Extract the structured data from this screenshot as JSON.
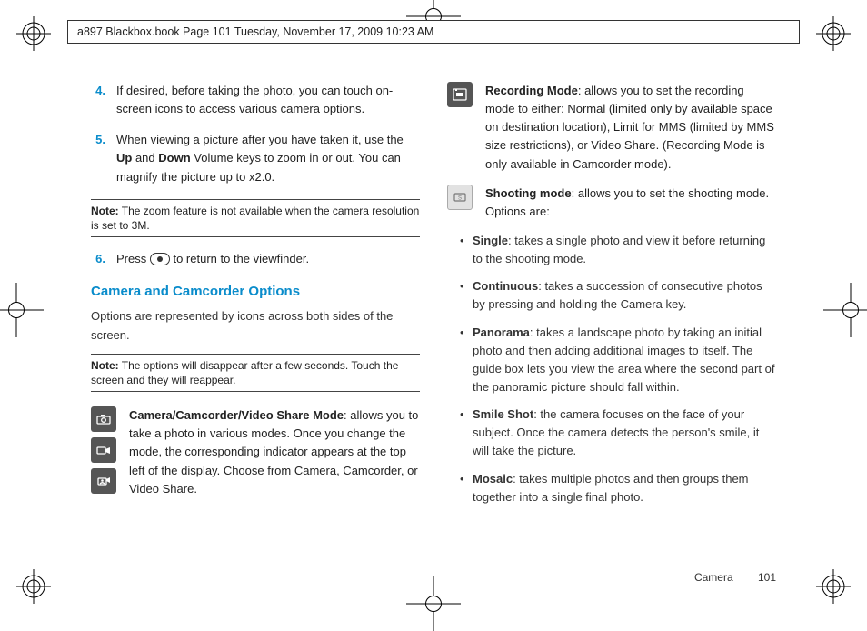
{
  "header": "a897 Blackbox.book  Page 101  Tuesday, November 17, 2009  10:23 AM",
  "left": {
    "steps": {
      "s4": {
        "n": "4.",
        "t": "If desired, before taking the photo, you can touch on-screen icons to access various camera options."
      },
      "s5": {
        "n": "5.",
        "pre": "When viewing a picture after you have taken it, use the ",
        "b1": "Up",
        "mid": " and ",
        "b2": "Down",
        "post": " Volume keys to zoom in or out. You can magnify the picture up to x2.0."
      },
      "s6": {
        "n": "6.",
        "pre": "Press ",
        "post": " to return to the viewfinder."
      }
    },
    "note1": {
      "label": "Note:",
      "t": " The zoom feature is not available when the camera resolution is set to 3M."
    },
    "heading": "Camera and Camcorder Options",
    "intro": "Options are represented by icons across both sides of the screen.",
    "note2": {
      "label": "Note:",
      "t": " The options will disappear after a few seconds. Touch the screen and they will reappear."
    },
    "camMode": {
      "b": "Camera/Camcorder/Video Share Mode",
      "t": ": allows you to take a photo in various modes. Once you change the mode, the corresponding indicator appears at the top left of the display. Choose from Camera, Camcorder, or Video Share."
    }
  },
  "right": {
    "recMode": {
      "b": "Recording Mode",
      "t": ": allows you to set the recording mode to either: Normal (limited only by available space on destination location), Limit for MMS (limited by MMS size restrictions), or Video Share. (Recording Mode is only available in Camcorder mode)."
    },
    "shootMode": {
      "b": "Shooting mode",
      "t": ": allows you to set the shooting mode. Options are:"
    },
    "bullets": {
      "single": {
        "b": "Single",
        "t": ": takes a single photo and view it before returning to the shooting mode."
      },
      "continuous": {
        "b": "Continuous",
        "t": ": takes a succession of consecutive photos by pressing and holding the Camera key."
      },
      "panorama": {
        "b": "Panorama",
        "t": ": takes a landscape photo by taking an initial photo and then adding additional images to itself. The guide box lets you view the area where the second part of the panoramic picture should fall within."
      },
      "smile": {
        "b": "Smile Shot",
        "t": ": the camera focuses on the face of your subject. Once the camera detects the person's smile, it will take the picture."
      },
      "mosaic": {
        "b": "Mosaic",
        "t": ": takes multiple photos and then groups them together into a single final photo."
      }
    }
  },
  "footer": {
    "section": "Camera",
    "page": "101"
  }
}
